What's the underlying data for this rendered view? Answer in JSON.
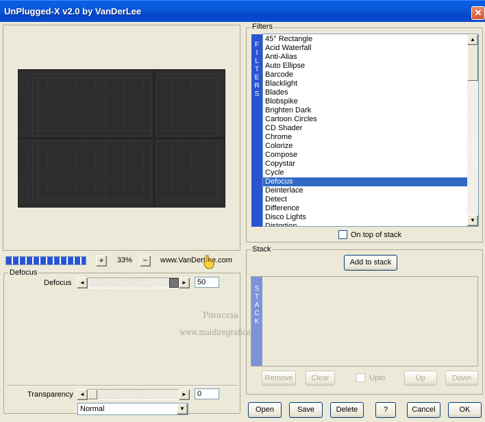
{
  "window": {
    "title": "UnPlugged-X v2.0 by VanDerLee",
    "close_icon": "close-icon"
  },
  "preview": {
    "zoom_label": "33%",
    "zoom_plus": "+",
    "zoom_minus": "−",
    "site": "www.VanDerLee.com",
    "progress_fraction": 1.0
  },
  "filters": {
    "label": "Filters",
    "tab_letters": [
      "F",
      "I",
      "L",
      "T",
      "E",
      "R",
      "S"
    ],
    "items": [
      "45° Rectangle",
      "Acid Waterfall",
      "Anti-Alias",
      "Auto Ellipse",
      "Barcode",
      "Blacklight",
      "Blades",
      "Blobspike",
      "Brighten Dark",
      "Cartoon Circles",
      "CD Shader",
      "Chrome",
      "Colorize",
      "Compose",
      "Copystar",
      "Cycle",
      "Defocus",
      "Deinterlace",
      "Detect",
      "Difference",
      "Disco Lights",
      "Distortion"
    ],
    "selected": "Defocus",
    "on_top_label": "On top of stack",
    "scroll_up": "▲",
    "scroll_down": "▼"
  },
  "params": {
    "group_label": "Defocus",
    "defocus_label": "Defocus",
    "defocus_value": "50",
    "defocus_level": 1.0,
    "transparency_label": "Transparency",
    "transparency_value": "0",
    "transparency_level": 0.0,
    "blend_mode": "Normal",
    "arrow_left": "◄",
    "arrow_right": "►",
    "arrow_down": "▼"
  },
  "watermark": {
    "line1": "Pinuccia",
    "line2": "www.maidiregrafica.eu"
  },
  "stack": {
    "label": "Stack",
    "add_button": "Add to stack",
    "tab_letters": [
      "S",
      "T",
      "A",
      "C",
      "K"
    ],
    "remove": "Remove",
    "clear": "Clear",
    "upto": "Upto",
    "up": "Up",
    "down": "Down"
  },
  "footer": {
    "open": "Open",
    "save": "Save",
    "delete": "Delete",
    "help": "?",
    "cancel": "Cancel",
    "ok": "OK"
  },
  "colors": {
    "title_bar": "#0b58d8",
    "selection": "#316ac5",
    "tab_blue": "#2a55d2",
    "stack_tab": "#7a93d9"
  }
}
